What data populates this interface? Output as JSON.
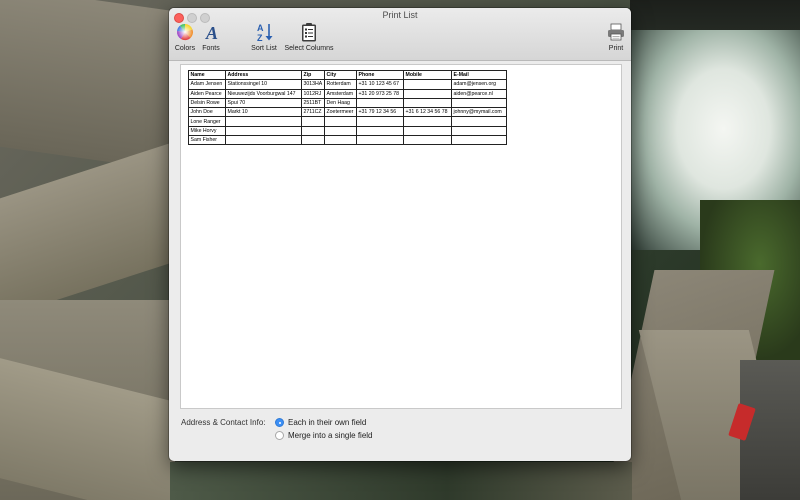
{
  "window": {
    "title": "Print List"
  },
  "toolbar": {
    "items": [
      {
        "label": "Colors",
        "icon": "color-wheel-icon"
      },
      {
        "label": "Fonts",
        "icon": "font-italic-a-icon"
      },
      {
        "label": "Sort List",
        "icon": "sort-az-icon"
      },
      {
        "label": "Select Columns",
        "icon": "clipboard-list-icon"
      },
      {
        "label": "Print",
        "icon": "printer-icon"
      }
    ]
  },
  "table": {
    "columns": [
      "Name",
      "Address",
      "Zip",
      "City",
      "Phone",
      "Mobile",
      "E-Mail"
    ],
    "rows": [
      [
        "Adam Jensen",
        "Stationssingel 10",
        "3013HA",
        "Rotterdam",
        "+31 10 123 45 67",
        "",
        "adam@jensen.org"
      ],
      [
        "Aiden Pearce",
        "Nieuwezijds Voorburgwal 147",
        "1012RJ",
        "Amsterdam",
        "+31 20 973 25 78",
        "",
        "aiden@pearce.nl"
      ],
      [
        "Delsin Rowe",
        "Spui 70",
        "2511BT",
        "Den Haag",
        "",
        "",
        ""
      ],
      [
        "John Doe",
        "Markt 10",
        "2711CZ",
        "Zoetermeer",
        "+31 79 12 34 56",
        "+31 6 12 34 56 78",
        "johnny@mymail.com"
      ],
      [
        "Lone Ranger",
        "",
        "",
        "",
        "",
        "",
        ""
      ],
      [
        "Mike Horvy",
        "",
        "",
        "",
        "",
        "",
        ""
      ],
      [
        "Sam Fisher",
        "",
        "",
        "",
        "",
        "",
        ""
      ]
    ]
  },
  "options": {
    "label": "Address & Contact Info:",
    "choices": [
      {
        "label": "Each in their own field",
        "selected": true
      },
      {
        "label": "Merge into a single field",
        "selected": false
      }
    ]
  },
  "colors": {
    "accent": "#3b8ff5",
    "close_button": "#fc605c"
  }
}
